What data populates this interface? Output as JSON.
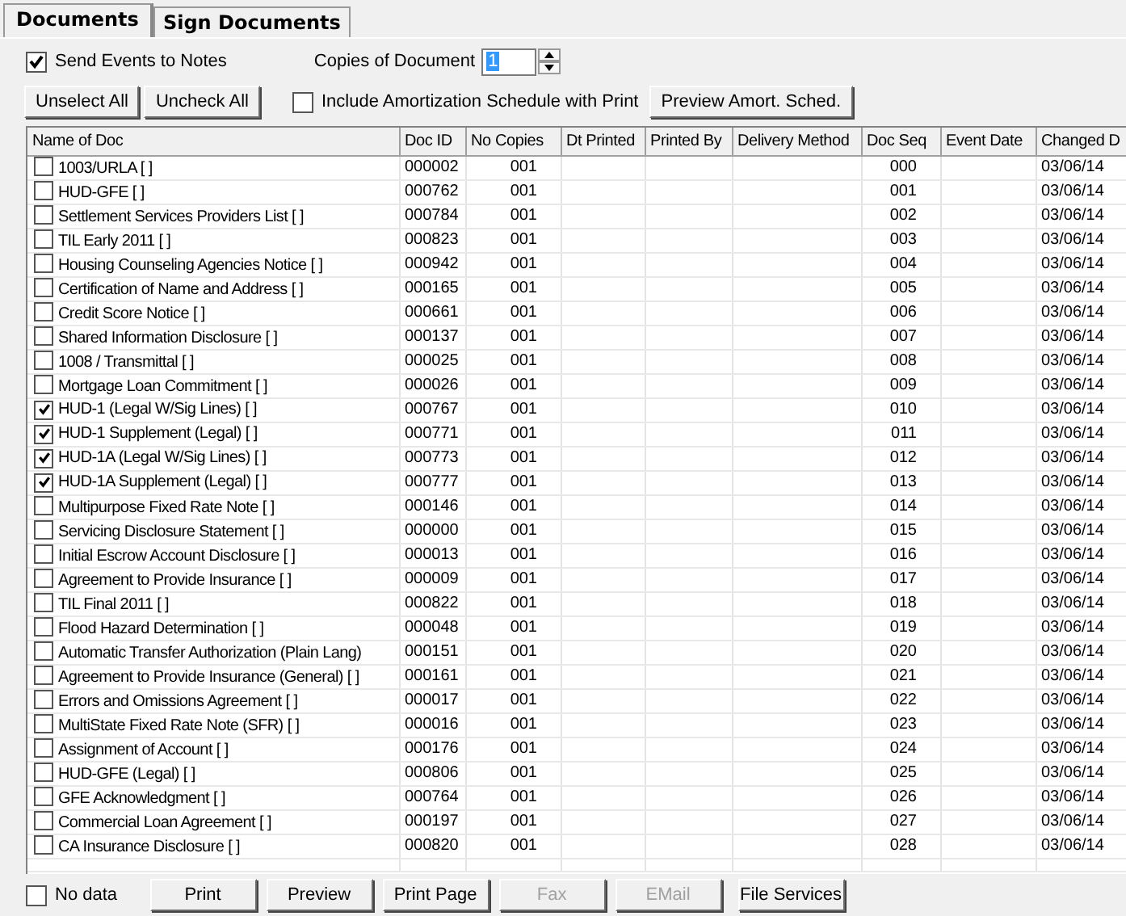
{
  "tabs": [
    {
      "label": "Documents",
      "selected": true
    },
    {
      "label": "Sign Documents",
      "selected": false
    }
  ],
  "send_events": {
    "label": "Send Events to Notes",
    "checked": true
  },
  "copies": {
    "label": "Copies of Document",
    "value": "1"
  },
  "buttons_top": [
    {
      "label": "Unselect All"
    },
    {
      "label": "Uncheck All"
    }
  ],
  "include_amort": {
    "label": "Include Amortization Schedule with Print",
    "checked": false
  },
  "preview_amort": {
    "label": "Preview Amort. Sched."
  },
  "table": {
    "columns": [
      "Name of Doc",
      "Doc ID",
      "No Copies",
      "Dt Printed",
      "Printed By",
      "Delivery Method",
      "Doc Seq",
      "Event Date",
      "Changed D"
    ],
    "rows": [
      {
        "name": "1003/URLA [ ]",
        "doc_id": "000002",
        "copies": "001",
        "seq": "000",
        "changed": "03/06/14",
        "checked": false
      },
      {
        "name": "HUD-GFE  [ ]",
        "doc_id": "000762",
        "copies": "001",
        "seq": "001",
        "changed": "03/06/14",
        "checked": false
      },
      {
        "name": "Settlement Services Providers List [ ]",
        "doc_id": "000784",
        "copies": "001",
        "seq": "002",
        "changed": "03/06/14",
        "checked": false
      },
      {
        "name": "TIL Early 2011 [ ]",
        "doc_id": "000823",
        "copies": "001",
        "seq": "003",
        "changed": "03/06/14",
        "checked": false
      },
      {
        "name": "Housing Counseling Agencies Notice [ ]",
        "doc_id": "000942",
        "copies": "001",
        "seq": "004",
        "changed": "03/06/14",
        "checked": false
      },
      {
        "name": "Certification of Name and Address [ ]",
        "doc_id": "000165",
        "copies": "001",
        "seq": "005",
        "changed": "03/06/14",
        "checked": false
      },
      {
        "name": "Credit Score Notice [ ]",
        "doc_id": "000661",
        "copies": "001",
        "seq": "006",
        "changed": "03/06/14",
        "checked": false
      },
      {
        "name": "Shared Information Disclosure [ ]",
        "doc_id": "000137",
        "copies": "001",
        "seq": "007",
        "changed": "03/06/14",
        "checked": false
      },
      {
        "name": "1008 / Transmittal [ ]",
        "doc_id": "000025",
        "copies": "001",
        "seq": "008",
        "changed": "03/06/14",
        "checked": false
      },
      {
        "name": "Mortgage Loan Commitment [ ]",
        "doc_id": "000026",
        "copies": "001",
        "seq": "009",
        "changed": "03/06/14",
        "checked": false
      },
      {
        "name": "HUD-1 (Legal W/Sig Lines) [ ]",
        "doc_id": "000767",
        "copies": "001",
        "seq": "010",
        "changed": "03/06/14",
        "checked": true
      },
      {
        "name": "HUD-1 Supplement (Legal) [ ]",
        "doc_id": "000771",
        "copies": "001",
        "seq": "011",
        "changed": "03/06/14",
        "checked": true
      },
      {
        "name": "HUD-1A (Legal W/Sig Lines) [ ]",
        "doc_id": "000773",
        "copies": "001",
        "seq": "012",
        "changed": "03/06/14",
        "checked": true
      },
      {
        "name": "HUD-1A Supplement (Legal) [ ]",
        "doc_id": "000777",
        "copies": "001",
        "seq": "013",
        "changed": "03/06/14",
        "checked": true
      },
      {
        "name": "Multipurpose Fixed Rate Note [ ]",
        "doc_id": "000146",
        "copies": "001",
        "seq": "014",
        "changed": "03/06/14",
        "checked": false
      },
      {
        "name": "Servicing Disclosure Statement [ ]",
        "doc_id": "000000",
        "copies": "001",
        "seq": "015",
        "changed": "03/06/14",
        "checked": false
      },
      {
        "name": "Initial Escrow Account Disclosure [ ]",
        "doc_id": "000013",
        "copies": "001",
        "seq": "016",
        "changed": "03/06/14",
        "checked": false
      },
      {
        "name": "Agreement to Provide Insurance [ ]",
        "doc_id": "000009",
        "copies": "001",
        "seq": "017",
        "changed": "03/06/14",
        "checked": false
      },
      {
        "name": "TIL Final 2011 [ ]",
        "doc_id": "000822",
        "copies": "001",
        "seq": "018",
        "changed": "03/06/14",
        "checked": false
      },
      {
        "name": "Flood Hazard Determination [ ]",
        "doc_id": "000048",
        "copies": "001",
        "seq": "019",
        "changed": "03/06/14",
        "checked": false
      },
      {
        "name": "Automatic Transfer Authorization (Plain Lang)",
        "doc_id": "000151",
        "copies": "001",
        "seq": "020",
        "changed": "03/06/14",
        "checked": false
      },
      {
        "name": "Agreement to Provide Insurance (General) [ ]",
        "doc_id": "000161",
        "copies": "001",
        "seq": "021",
        "changed": "03/06/14",
        "checked": false
      },
      {
        "name": "Errors and Omissions Agreement [ ]",
        "doc_id": "000017",
        "copies": "001",
        "seq": "022",
        "changed": "03/06/14",
        "checked": false
      },
      {
        "name": "MultiState Fixed Rate Note (SFR) [ ]",
        "doc_id": "000016",
        "copies": "001",
        "seq": "023",
        "changed": "03/06/14",
        "checked": false
      },
      {
        "name": "Assignment of Account [ ]",
        "doc_id": "000176",
        "copies": "001",
        "seq": "024",
        "changed": "03/06/14",
        "checked": false
      },
      {
        "name": "HUD-GFE (Legal) [ ]",
        "doc_id": "000806",
        "copies": "001",
        "seq": "025",
        "changed": "03/06/14",
        "checked": false
      },
      {
        "name": "GFE Acknowledgment [ ]",
        "doc_id": "000764",
        "copies": "001",
        "seq": "026",
        "changed": "03/06/14",
        "checked": false
      },
      {
        "name": "Commercial Loan Agreement [ ]",
        "doc_id": "000197",
        "copies": "001",
        "seq": "027",
        "changed": "03/06/14",
        "checked": false
      },
      {
        "name": "CA Insurance Disclosure [ ]",
        "doc_id": "000820",
        "copies": "001",
        "seq": "028",
        "changed": "03/06/14",
        "checked": false
      }
    ]
  },
  "no_data": {
    "label": "No data",
    "checked": false
  },
  "buttons_bottom": [
    {
      "label": "Print",
      "disabled": false
    },
    {
      "label": "Preview",
      "disabled": false
    },
    {
      "label": "Print Page",
      "disabled": false
    },
    {
      "label": "Fax",
      "disabled": true
    },
    {
      "label": "EMail",
      "disabled": true
    },
    {
      "label": "File Services",
      "disabled": false
    }
  ]
}
